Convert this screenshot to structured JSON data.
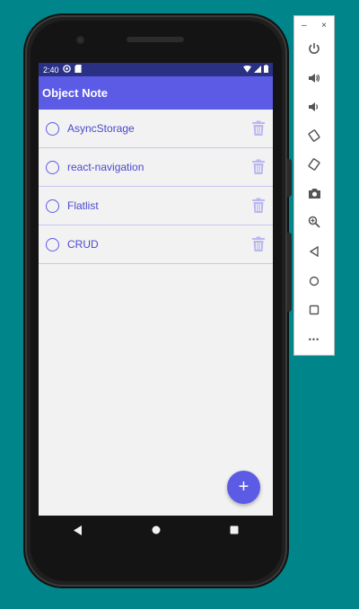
{
  "status_bar": {
    "time": "2:40"
  },
  "app": {
    "title": "Object Note",
    "accent_color": "#5b5be6"
  },
  "notes": [
    {
      "label": "AsyncStorage"
    },
    {
      "label": "react-navigation"
    },
    {
      "label": "Flatlist"
    },
    {
      "label": "CRUD"
    }
  ],
  "fab": {
    "label": "+"
  },
  "emulator_panel": {
    "minimize_label": "–",
    "close_label": "×",
    "buttons": [
      "power-icon",
      "volume-up-icon",
      "volume-down-icon",
      "rotate-left-icon",
      "rotate-right-icon",
      "camera-icon",
      "zoom-icon",
      "back-icon",
      "home-icon",
      "overview-icon",
      "more-icon"
    ],
    "more_label": "•••"
  },
  "navigation_bar": {
    "buttons": [
      "back-icon",
      "home-icon",
      "recents-icon"
    ]
  }
}
